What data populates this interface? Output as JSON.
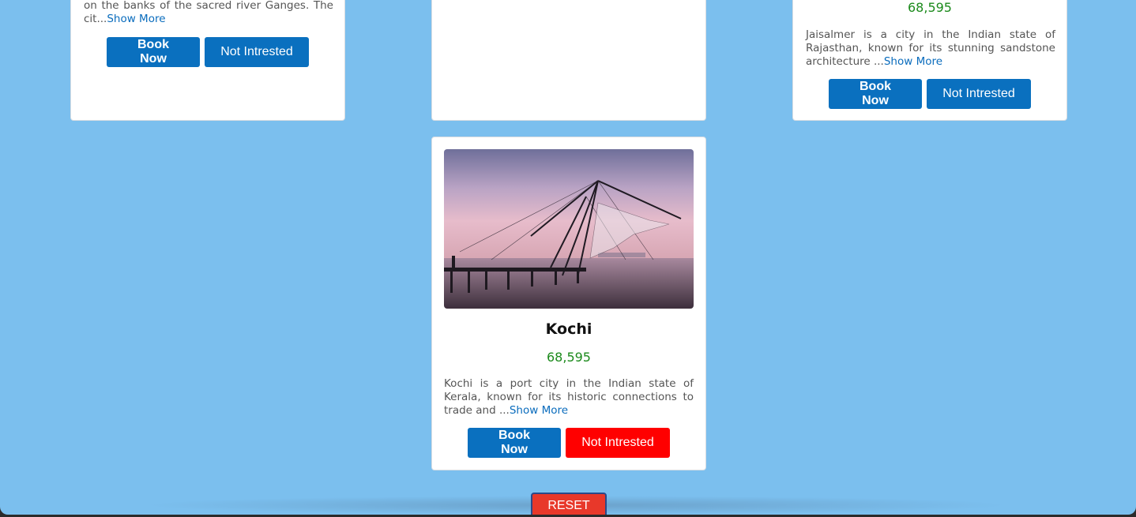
{
  "cards": {
    "left": {
      "desc_text": "on the banks of the sacred river Ganges. The cit...",
      "show_more": "Show More",
      "book_label": "Book Now",
      "not_label": "Not Intrested"
    },
    "right": {
      "price": "68,595",
      "desc_text": "Jaisalmer is a city in the Indian state of Rajasthan, known for its stunning sandstone architecture ...",
      "show_more": "Show More",
      "book_label": "Book Now",
      "not_label": "Not Intrested"
    },
    "kochi": {
      "title": "Kochi",
      "price": "68,595",
      "desc_text": "Kochi is a port city in the Indian state of Kerala, known for its historic connections to trade and ...",
      "show_more": "Show More",
      "book_label": "Book Now",
      "not_label": "Not Intrested"
    }
  },
  "reset_label": "RESET",
  "colors": {
    "background": "#7bbfee",
    "primary_button": "#0a70bf",
    "not_interested_active": "#ff0000",
    "price": "#1c8a1c",
    "link": "#0a6cbd",
    "reset": "#e8382a"
  }
}
